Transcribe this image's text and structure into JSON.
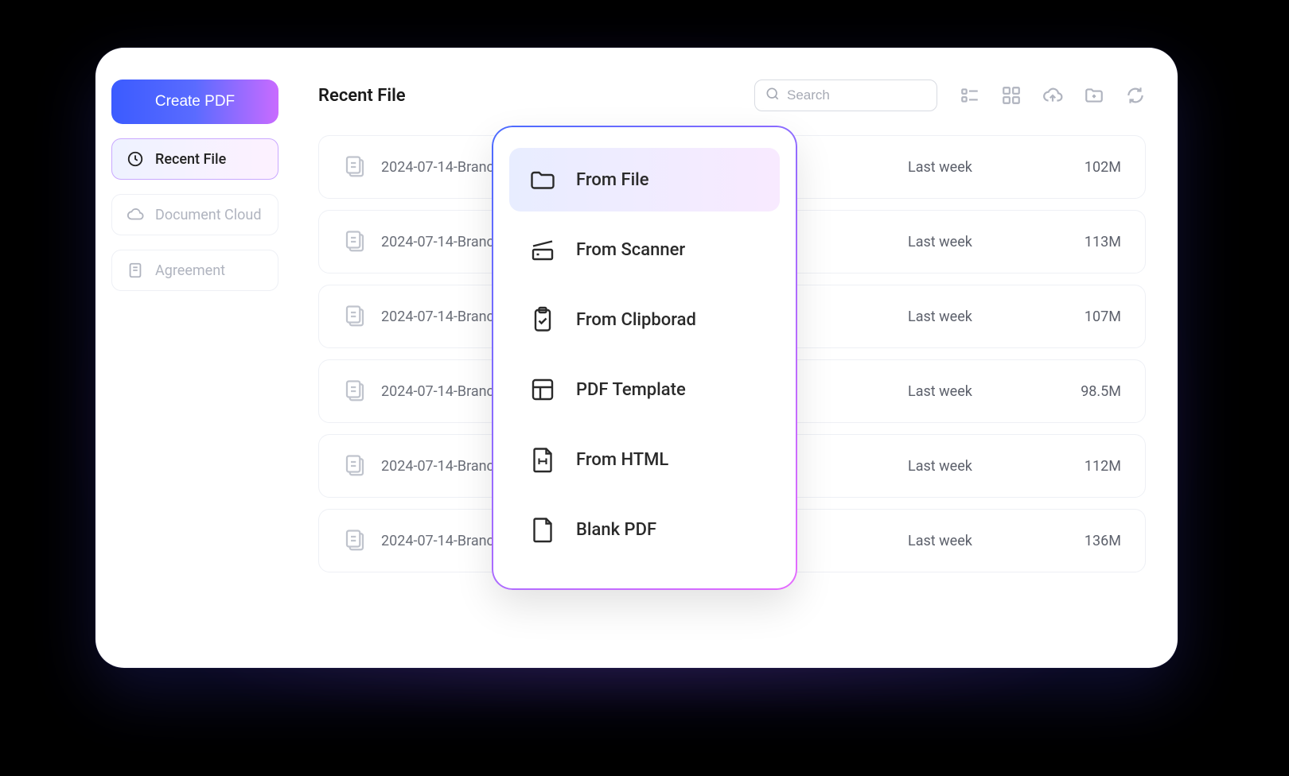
{
  "sidebar": {
    "create_label": "Create PDF",
    "items": [
      {
        "label": "Recent File"
      },
      {
        "label": "Document Cloud"
      },
      {
        "label": "Agreement"
      }
    ]
  },
  "header": {
    "title": "Recent File",
    "search_placeholder": "Search"
  },
  "files": [
    {
      "name": "2024-07-14-Branc",
      "date": "Last week",
      "size": "102M"
    },
    {
      "name": "2024-07-14-Branc",
      "date": "Last week",
      "size": "113M"
    },
    {
      "name": "2024-07-14-Branc",
      "date": "Last week",
      "size": "107M"
    },
    {
      "name": "2024-07-14-Branc",
      "date": "Last week",
      "size": "98.5M"
    },
    {
      "name": "2024-07-14-Branc",
      "date": "Last week",
      "size": "112M"
    },
    {
      "name": "2024-07-14-Branc",
      "date": "Last week",
      "size": "136M"
    }
  ],
  "create_menu": [
    {
      "label": "From File"
    },
    {
      "label": "From Scanner"
    },
    {
      "label": "From Clipborad"
    },
    {
      "label": "PDF Template"
    },
    {
      "label": "From HTML"
    },
    {
      "label": "Blank PDF"
    }
  ]
}
